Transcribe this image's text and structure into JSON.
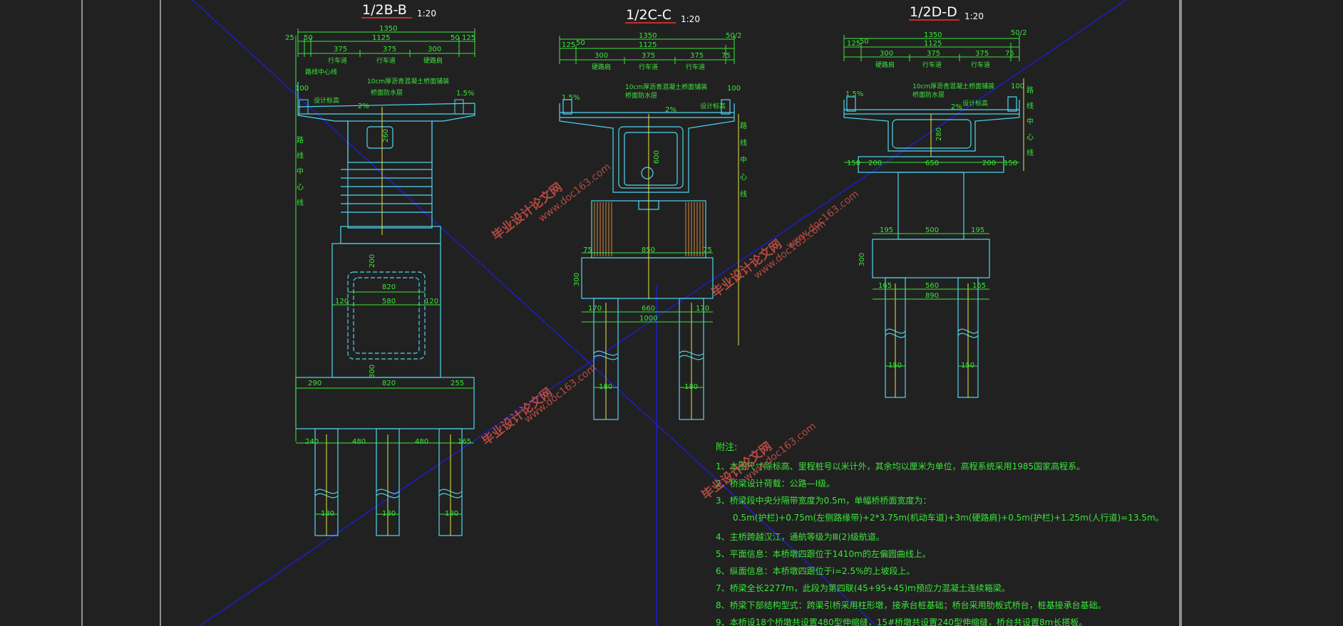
{
  "colors": {
    "background": "#212121",
    "structure": "#4fd6f0",
    "dimension": "#39e639",
    "centerline": "#e8e84a",
    "frame": "#ffffff",
    "guide": "#1e1ec8",
    "watermark": "#d9554a",
    "hatch": "#d68a3a"
  },
  "sections": {
    "b": {
      "title": "1/2B-B",
      "scale": "1:20",
      "top_dims": [
        "1350",
        "25",
        "50",
        "1125",
        "50",
        "125",
        "375",
        "375",
        "300"
      ],
      "lanes": [
        "行车道",
        "行车道",
        "硬路肩"
      ],
      "notes": [
        "路线中心线",
        "10cm厚沥青混凝土桥面铺装",
        "桥面防水层",
        "设计标高"
      ],
      "slopes": [
        "2%",
        "1.5%"
      ],
      "heights": [
        "100",
        "260",
        "200",
        "300"
      ],
      "vertical_label": "路线中心线",
      "pier_dims": [
        "820",
        "120",
        "580",
        "120"
      ],
      "cap_dims": [
        "290",
        "820",
        "255"
      ],
      "pile_dims": [
        "240",
        "480",
        "480",
        "165"
      ],
      "pile_dia": [
        "180",
        "180",
        "180"
      ]
    },
    "c": {
      "title": "1/2C-C",
      "scale": "1:20",
      "top_dims": [
        "1350",
        "125",
        "50",
        "1125",
        "50/2",
        "300",
        "375",
        "375",
        "75"
      ],
      "lanes": [
        "硬路肩",
        "行车道",
        "行车道"
      ],
      "notes": [
        "10cm厚沥青混凝土桥面铺装",
        "桥面防水层",
        "设计标高"
      ],
      "slopes": [
        "1.5%",
        "2%"
      ],
      "heights": [
        "100",
        "600",
        "300"
      ],
      "vertical_label": "路线中心线",
      "cap_dims": [
        "75",
        "850",
        "75"
      ],
      "pile_dims": [
        "170",
        "660",
        "170",
        "1000"
      ],
      "pile_dia": [
        "180",
        "180"
      ]
    },
    "d": {
      "title": "1/2D-D",
      "scale": "1:20",
      "top_dims": [
        "1350",
        "125",
        "50",
        "1125",
        "50/2",
        "300",
        "375",
        "375",
        "75"
      ],
      "lanes": [
        "硬路肩",
        "行车道",
        "行车道"
      ],
      "notes": [
        "10cm厚沥青混凝土桥面铺装",
        "桥面防水层",
        "设计标高"
      ],
      "slopes": [
        "1.5%",
        "2%"
      ],
      "heights": [
        "100",
        "280",
        "300"
      ],
      "vertical_label": "路线中心线",
      "base_dims": [
        "150",
        "200",
        "650",
        "200",
        "150"
      ],
      "col_dims": [
        "195",
        "500",
        "195"
      ],
      "pile_dims": [
        "165",
        "560",
        "165",
        "890"
      ],
      "pile_dia": [
        "150",
        "150"
      ]
    }
  },
  "notes": {
    "heading": "附注:",
    "items": [
      "1、本图尺寸除标高、里程桩号以米计外，其余均以厘米为单位，高程系统采用1985国家高程系。",
      "2、桥梁设计荷载：公路—Ⅰ级。",
      "3、桥梁段中央分隔带宽度为0.5m，单幅桥桥面宽度为：",
      "　　0.5m(护栏)+0.75m(左侧路缘带)+2*3.75m(机动车道)+3m(硬路肩)+0.5m(护栏)+1.25m(人行道)=13.5m。",
      "4、主桥跨越汉江，通航等级为Ⅲ(2)级航道。",
      "5、平面信息：本桥墩四跟位于1410m的左偏圆曲线上。",
      "6、纵面信息：本桥墩四跟位于i=2.5%的上坡段上。",
      "7、桥梁全长2277m，此段为第四联(45+95+45)m预应力混凝土连续箱梁。",
      "8、桥梁下部结构型式：跨渠引桥采用柱形墩，接承台桩基础；桥台采用肋板式桥台，桩基接承台基础。",
      "9、本桥设18个桥墩共设置480型伸缩缝，15#桥墩共设置240型伸缩缝，桥台共设置8m长搭板。"
    ]
  },
  "watermarks": [
    "毕业设计论文网",
    "www.doc163.com"
  ]
}
